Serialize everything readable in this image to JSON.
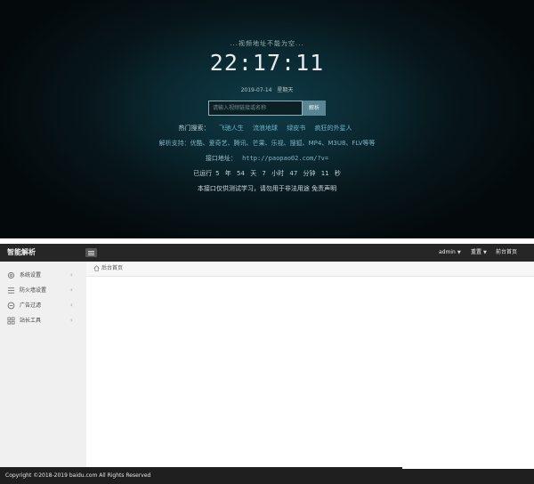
{
  "landing": {
    "notice": "...视频地址不能为空...",
    "clock": "22:17:11",
    "date": "2019-07-14",
    "weekday": "星期天",
    "search": {
      "placeholder": "请输入视频链接或名称",
      "button": "解析"
    },
    "hot_label": "热门搜索：",
    "hot_keywords": [
      "飞驰人生",
      "流浪地球",
      "绿皮书",
      "疯狂的外星人"
    ],
    "support_text": "解析支持：优酷、爱奇艺、腾讯、芒果、乐视、搜狐、MP4、M3U8、FLV等等",
    "api_label": "接口地址：",
    "api_url": "http://paopao02.com/?v=",
    "uptime": {
      "prefix": "已运行",
      "years": "5",
      "years_unit": "年",
      "days": "54",
      "days_unit": "天",
      "hours": "7",
      "hours_unit": "小时",
      "minutes": "47",
      "minutes_unit": "分钟",
      "seconds": "11",
      "seconds_unit": "秒"
    },
    "disclaimer": "本接口仅供测试学习，请勿用于非法用途 免责声明"
  },
  "admin": {
    "brand": "智能解析",
    "topbar": {
      "user": "admin",
      "refresh": "重置",
      "front": "前台首页"
    },
    "sidebar": [
      {
        "label": "系统设置",
        "icon": "gear-icon"
      },
      {
        "label": "防火墙设置",
        "icon": "list-icon"
      },
      {
        "label": "广告过滤",
        "icon": "minus-circle-icon"
      },
      {
        "label": "站长工具",
        "icon": "grid-icon"
      }
    ],
    "tab_home": "后台首页",
    "footer": "Copyright ©2018-2019 baidu.com All Rights Reserved"
  },
  "colors": {
    "landing_bg": "#0b2a33",
    "accent_link": "#6fb3c7",
    "search_button": "#5a8694",
    "admin_topbar": "#262626",
    "sidebar_bg": "#f0f0f0"
  }
}
